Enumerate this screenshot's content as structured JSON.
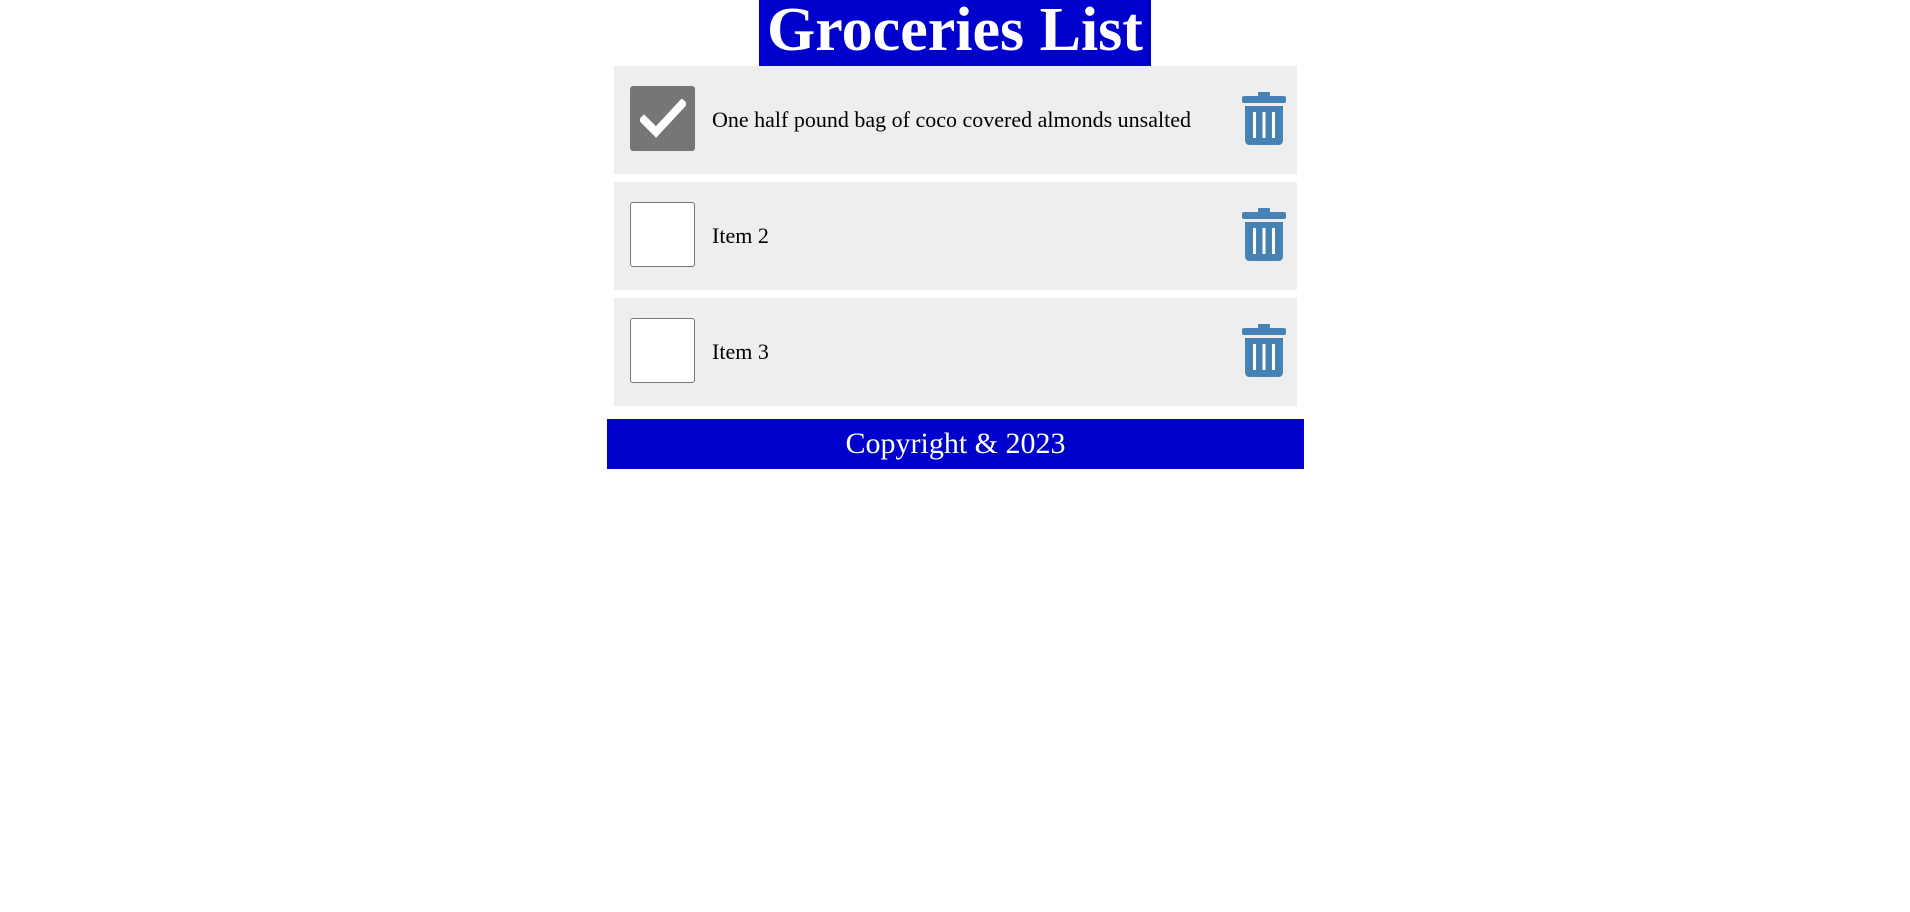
{
  "header": {
    "title": "Groceries List"
  },
  "items": [
    {
      "label": "One half pound bag of coco covered almonds unsalted",
      "checked": true
    },
    {
      "label": "Item 2",
      "checked": false
    },
    {
      "label": "Item 3",
      "checked": false
    }
  ],
  "icons": {
    "check": "check-icon",
    "delete": "trash-icon"
  },
  "colors": {
    "header_bg": "#0000cc",
    "footer_bg": "#0000cc",
    "item_bg": "#eeeeee",
    "trash": "#4682b4",
    "checked_bg": "#767676"
  },
  "footer": {
    "text": "Copyright & 2023"
  }
}
